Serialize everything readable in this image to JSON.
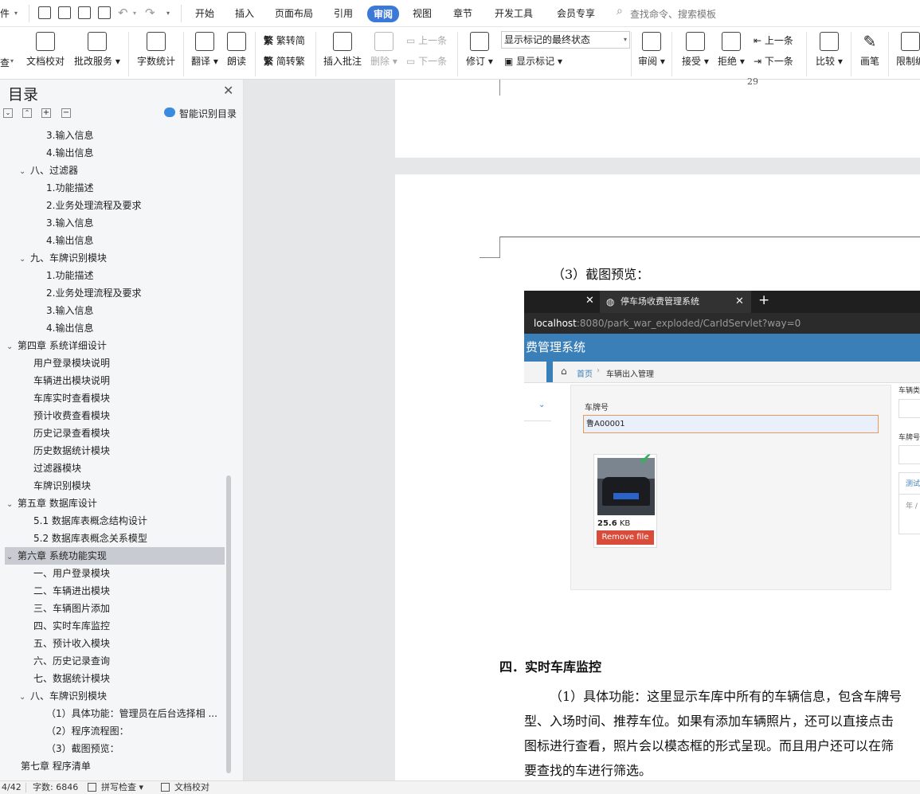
{
  "menubar": {
    "file_fragment": "件",
    "tabs": [
      "开始",
      "插入",
      "页面布局",
      "引用",
      "审阅",
      "视图",
      "章节",
      "开发工具",
      "会员专享"
    ],
    "active_tab": "审阅",
    "search_placeholder": "查找命令、搜索模板"
  },
  "ribbon": {
    "partial_left": "查",
    "doc_check": "文档校对",
    "batch_service": "批改服务",
    "word_count": "字数统计",
    "translate": "翻译",
    "read_aloud": "朗读",
    "trad": "繁转简",
    "simp": "简转繁",
    "insert_comment": "插入批注",
    "delete": "删除",
    "prev": "上一条",
    "next": "下一条",
    "revise": "修订",
    "display_mode": "显示标记的最终状态",
    "show_markup": "显示标记",
    "review": "审阅",
    "accept": "接受",
    "reject": "拒绝",
    "prev2": "上一条",
    "next2": "下一条",
    "compare": "比较",
    "pen": "画笔",
    "restrict": "限制编"
  },
  "toc": {
    "title": "目录",
    "smart": "智能识别目录",
    "items": [
      {
        "text": "3.输入信息",
        "level": 2
      },
      {
        "text": "4.输出信息",
        "level": 2
      },
      {
        "text": "八、过滤器",
        "level": 1,
        "caret": true
      },
      {
        "text": "1.功能描述",
        "level": 2
      },
      {
        "text": "2.业务处理流程及要求",
        "level": 2
      },
      {
        "text": "3.输入信息",
        "level": 2
      },
      {
        "text": "4.输出信息",
        "level": 2
      },
      {
        "text": "九、车牌识别模块",
        "level": 1,
        "caret": true
      },
      {
        "text": "1.功能描述",
        "level": 2
      },
      {
        "text": "2.业务处理流程及要求",
        "level": 2
      },
      {
        "text": "3.输入信息",
        "level": 2
      },
      {
        "text": "4.输出信息",
        "level": 2
      },
      {
        "text": "第四章  系统详细设计",
        "level": 0,
        "caret": true
      },
      {
        "text": "用户登录模块说明",
        "level": 1
      },
      {
        "text": "车辆进出模块说明",
        "level": 1
      },
      {
        "text": "车库实时查看模块",
        "level": 1
      },
      {
        "text": "预计收费查看模块",
        "level": 1
      },
      {
        "text": "历史记录查看模块",
        "level": 1
      },
      {
        "text": "历史数据统计模块",
        "level": 1
      },
      {
        "text": "过滤器模块",
        "level": 1
      },
      {
        "text": "车牌识别模块",
        "level": 1
      },
      {
        "text": "第五章  数据库设计",
        "level": 0,
        "caret": true
      },
      {
        "text": "5.1 数据库表概念结构设计",
        "level": 1
      },
      {
        "text": "5.2 数据库表概念关系模型",
        "level": 1
      },
      {
        "text": "第六章  系统功能实现",
        "level": 0,
        "caret": true,
        "selected": true
      },
      {
        "text": "一、用户登录模块",
        "level": 1
      },
      {
        "text": "二、车辆进出模块",
        "level": 1
      },
      {
        "text": "三、车辆图片添加",
        "level": 1
      },
      {
        "text": "四、实时车库监控",
        "level": 1
      },
      {
        "text": "五、预计收入模块",
        "level": 1
      },
      {
        "text": "六、历史记录查询",
        "level": 1
      },
      {
        "text": "七、数据统计模块",
        "level": 1
      },
      {
        "text": "八、车牌识别模块",
        "level": 1,
        "caret": true
      },
      {
        "text": "（1）具体功能：管理员在后台选择相 ...",
        "level": 2
      },
      {
        "text": "（2）程序流程图：",
        "level": 2
      },
      {
        "text": "（3）截图预览：",
        "level": 2
      },
      {
        "text": "第七章  程序清单",
        "level": 0
      }
    ]
  },
  "doc": {
    "page_number": "29",
    "caption": "（3）截图预览：",
    "heading": "四．实时车库监控",
    "para_lines": [
      "（1）具体功能：这里显示车库中所有的车辆信息，包含车牌号",
      "型、入场时间、推荐车位。如果有添加车辆照片，还可以直接点击",
      "图标进行查看，照片会以模态框的形式呈现。而且用户还可以在筛",
      "要查找的车进行筛选。"
    ]
  },
  "screenshot": {
    "tab_title": "停车场收费管理系统",
    "url_host": "localhost",
    "url_rest": ":8080/park_war_exploded/CarIdServlet?way=0",
    "app_title": "费管理系统",
    "crumb_home": "首页",
    "crumb_current": "车辆出入管理",
    "plate_label": "车牌号",
    "plate_value": "鲁A00001",
    "file_size": "25.6",
    "file_unit": "KB",
    "remove": "Remove file",
    "right_label1": "车辆类",
    "right_label2": "车牌号",
    "right_tab": "测试",
    "right_date": "年 /"
  },
  "status": {
    "page": "4/42",
    "words": "字数: 6846",
    "spell": "拼写检查",
    "doc_check": "文档校对"
  }
}
